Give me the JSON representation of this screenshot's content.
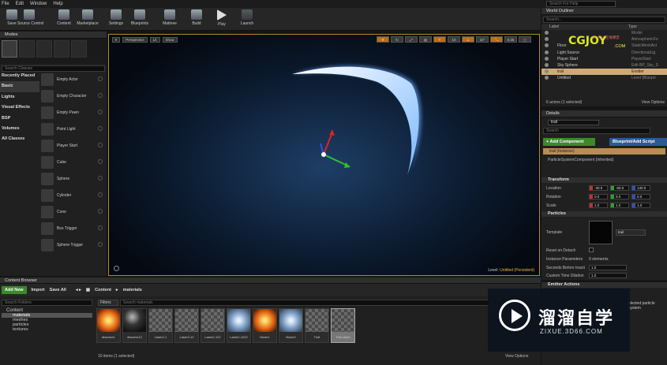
{
  "menu": [
    "File",
    "Edit",
    "Window",
    "Help"
  ],
  "search_help": "Search For Help",
  "toolbar": [
    {
      "label": "Save",
      "icon": "save-icon"
    },
    {
      "label": "Source Control",
      "icon": "source-control-icon"
    },
    {
      "label": "Content",
      "icon": "content-icon"
    },
    {
      "label": "Marketplace",
      "icon": "marketplace-icon"
    },
    {
      "label": "Settings",
      "icon": "settings-icon"
    },
    {
      "label": "Blueprints",
      "icon": "blueprints-icon"
    },
    {
      "label": "Matinee",
      "icon": "matinee-icon"
    },
    {
      "label": "Build",
      "icon": "build-icon"
    },
    {
      "label": "Play",
      "icon": "play-icon"
    },
    {
      "label": "Launch",
      "icon": "launch-icon"
    }
  ],
  "modes": {
    "title": "Modes",
    "search_placeholder": "Search Classes",
    "categories": [
      "Recently Placed",
      "Basic",
      "Lights",
      "Visual Effects",
      "BSP",
      "Volumes",
      "All Classes"
    ],
    "selected_category": 1,
    "classes": [
      "Empty Actor",
      "Empty Character",
      "Empty Pawn",
      "Point Light",
      "Player Start",
      "Cube",
      "Sphere",
      "Cylinder",
      "Cone",
      "Box Trigger",
      "Sphere Trigger"
    ]
  },
  "viewport": {
    "perspective": "Perspective",
    "lit": "Lit",
    "show": "Show",
    "snap_values": [
      "10",
      "10°",
      "0.25"
    ],
    "level_label": "Level:",
    "level_name": "Untitled (Persistent)"
  },
  "outliner": {
    "title": "World Outliner",
    "search_placeholder": "Search...",
    "col_label": "Label",
    "col_type": "Type",
    "rows": [
      {
        "label": "",
        "type": "Model"
      },
      {
        "label": "",
        "type": "AtmosphericFo"
      },
      {
        "label": "Floor",
        "type": "StaticMeshAct"
      },
      {
        "label": "Light Source",
        "type": "DirectionalLig"
      },
      {
        "label": "Player Start",
        "type": "PlayerStart"
      },
      {
        "label": "Sky Sphere",
        "type": "Edit BP_Sky_S"
      },
      {
        "label": "trail",
        "type": "Emitter"
      },
      {
        "label": "Untitled",
        "type": "Level (Bluepri"
      }
    ],
    "selected_row": 6,
    "count": "6 actors (1 selected)",
    "view_options": "View Options"
  },
  "details": {
    "title": "Details",
    "name": "trail",
    "search_placeholder": "Search",
    "add_component": "+ Add Component",
    "blueprint_script": "Blueprint/Add Script",
    "instance": "trail (Instance)",
    "component": "ParticleSystemComponent (Inherited)",
    "transform_title": "Transform",
    "location_label": "Location",
    "location": [
      "-30.0",
      "-60.0",
      "130.0"
    ],
    "rotation_label": "Rotation",
    "rotation": [
      "0.0",
      "0.0",
      "0.0"
    ],
    "scale_label": "Scale",
    "scale": [
      "1.0",
      "1.0",
      "1.0"
    ],
    "particles_title": "Particles",
    "template_label": "Template",
    "template_value": "trail",
    "reset_on_detach": "Reset on Detach",
    "instance_params": "Instance Parameters",
    "instance_params_value": "0 elements",
    "seconds_before_inactive": "Seconds Before Inacti",
    "seconds_before_inactive_value": "1.0",
    "custom_time_dilation": "Custom Time Dilation",
    "custom_time_dilation_value": "1.0",
    "emitter_actions": "Emitter Actions",
    "selected_particle": "elected particle system"
  },
  "content_browser": {
    "title": "Content Browser",
    "add_new": "Add New",
    "import": "Import",
    "save_all": "Save All",
    "path_root": "Content",
    "path_current": "materials",
    "search_folders": "Search Folders",
    "filters": "Filters",
    "search_assets": "Search materials",
    "folders": [
      {
        "name": "Content",
        "level": 0
      },
      {
        "name": "materials",
        "level": 1
      },
      {
        "name": "meshes",
        "level": 1
      },
      {
        "name": "particles",
        "level": 1
      },
      {
        "name": "textures",
        "level": 1
      }
    ],
    "selected_folder": 1,
    "assets": [
      {
        "name": "dissolve1",
        "kind": "fire"
      },
      {
        "name": "dissolve12",
        "kind": "dark"
      },
      {
        "name": "Laser2-1",
        "kind": "grid"
      },
      {
        "name": "Laser2-12",
        "kind": "grid"
      },
      {
        "name": "Laser2-122",
        "kind": "grid"
      },
      {
        "name": "Laser2-1222",
        "kind": "glow"
      },
      {
        "name": "Noise1",
        "kind": "fire"
      },
      {
        "name": "Noise2",
        "kind": "glow"
      },
      {
        "name": "Trail",
        "kind": "grid"
      },
      {
        "name": "Trail-objec",
        "kind": "grid"
      }
    ],
    "selected_asset": 9,
    "item_count": "10 items (1 selected)",
    "view_options": "View Options"
  },
  "watermark": {
    "cn": "溜溜自学",
    "url": "ZIXUE.3D66.COM",
    "cg_big": "CGJOY",
    "cg_small": "CGJOY 在线课堂",
    "cg_com": ".COM"
  }
}
